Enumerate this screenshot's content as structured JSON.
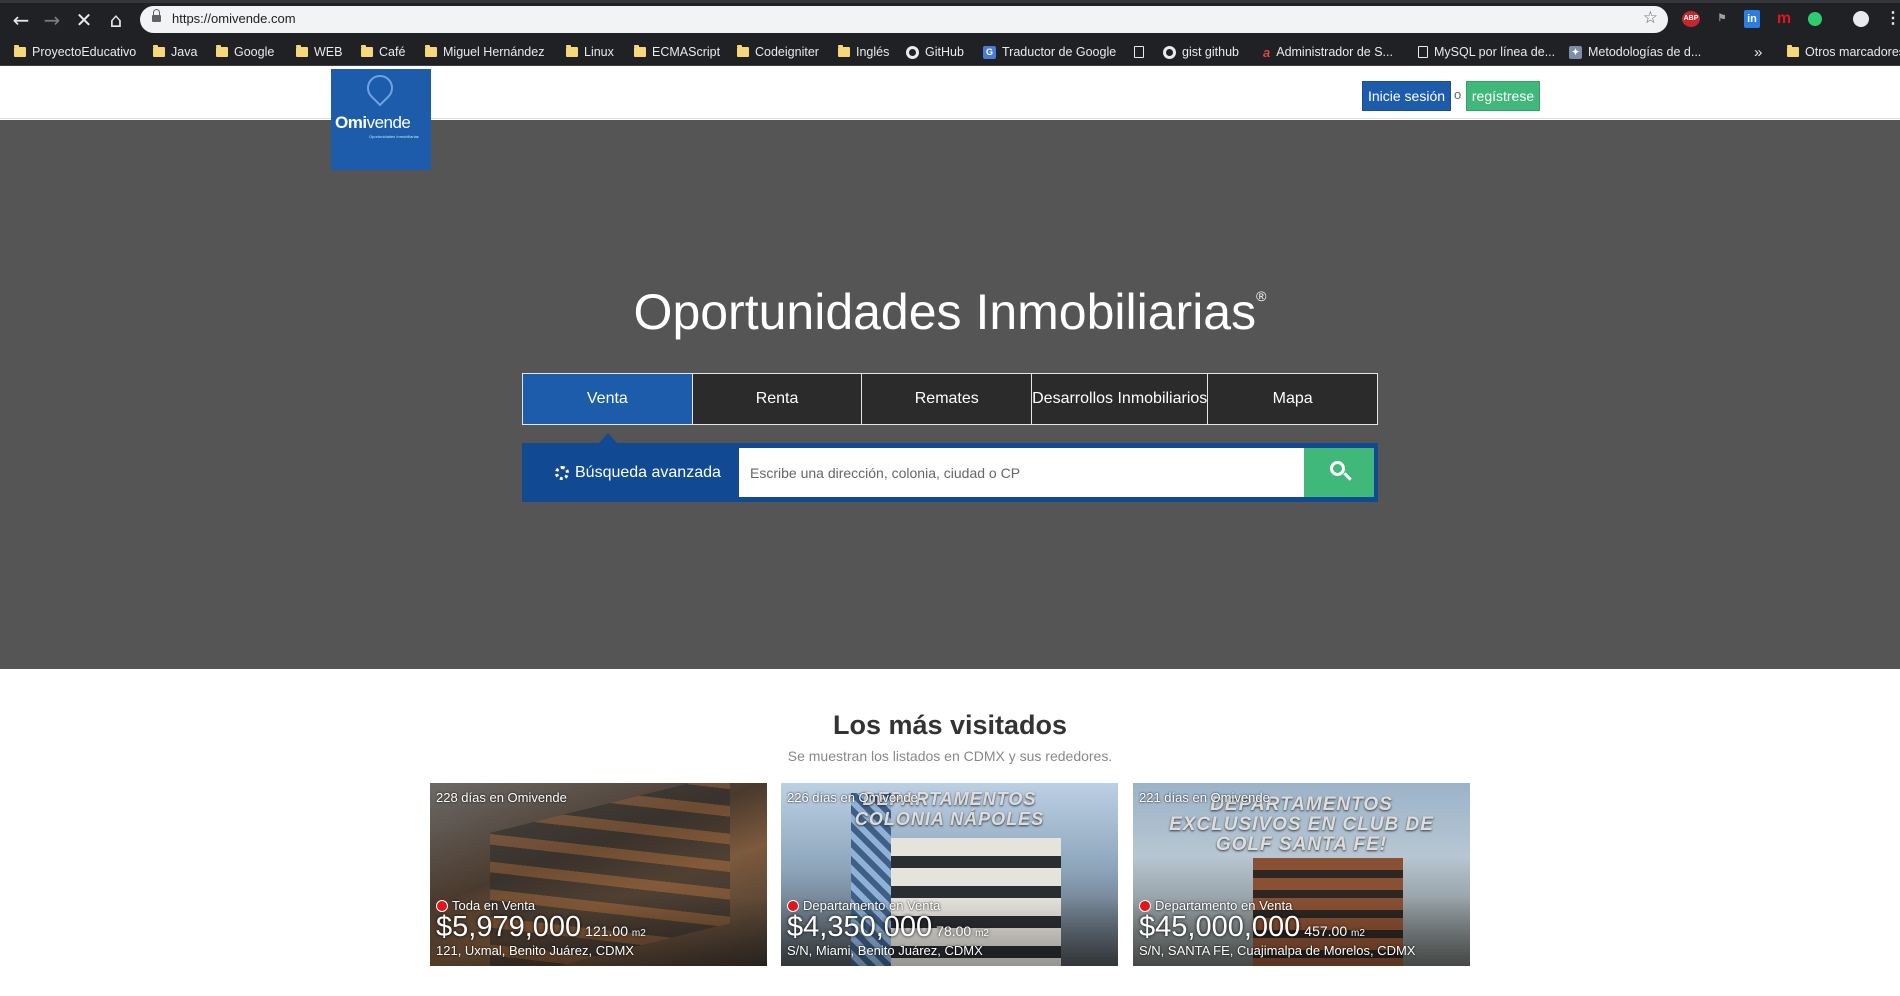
{
  "browser": {
    "url": "https://omivende.com",
    "bookmarks": [
      {
        "label": "ProyectoEducativo",
        "icon": "folder-icon"
      },
      {
        "label": "Java",
        "icon": "folder-icon"
      },
      {
        "label": "Google",
        "icon": "folder-icon"
      },
      {
        "label": "WEB",
        "icon": "folder-icon"
      },
      {
        "label": "Café",
        "icon": "folder-icon"
      },
      {
        "label": "Miguel Hernández",
        "icon": "folder-icon"
      },
      {
        "label": "Linux",
        "icon": "folder-icon"
      },
      {
        "label": "ECMAScript",
        "icon": "folder-icon"
      },
      {
        "label": "Codeigniter",
        "icon": "folder-icon"
      },
      {
        "label": "Inglés",
        "icon": "folder-icon"
      },
      {
        "label": "GitHub",
        "icon": "github-icon"
      },
      {
        "label": "Traductor de Google",
        "icon": "google-translate-icon"
      },
      {
        "label": "",
        "icon": "page-icon"
      },
      {
        "label": "gist github",
        "icon": "github-icon"
      },
      {
        "label": "Administrador de S...",
        "icon": "admin-icon"
      },
      {
        "label": "MySQL por línea de...",
        "icon": "page-icon"
      },
      {
        "label": "Metodologías de d...",
        "icon": "site-icon"
      },
      {
        "label": "Otros marcadores",
        "icon": "folder-icon"
      }
    ],
    "overflow_label": "»",
    "extensions": [
      "ABP",
      "in",
      "m"
    ]
  },
  "header": {
    "logo_text_bold": "Omi",
    "logo_text": "vende",
    "logo_sub": "Oportunidades Inmobiliarias",
    "login_label": "Inicie sesión",
    "or_label": "o",
    "register_label": "regístrese"
  },
  "hero": {
    "title": "Oportunidades Inmobiliarias",
    "title_mark": "®",
    "tabs": [
      "Venta",
      "Renta",
      "Remates",
      "Desarrollos Inmobiliarios",
      "Mapa"
    ],
    "active_tab": "Venta",
    "advanced_search_label": "Búsqueda avanzada",
    "search_placeholder": "Escribe una dirección, colonia, ciudad o CP"
  },
  "most_visited": {
    "title": "Los más visitados",
    "subtitle": "Se muestran los listados en CDMX y sus rededores.",
    "cards": [
      {
        "days": "228 días en Omivende",
        "type": "Toda en Venta",
        "price": "$5,979,000",
        "area": "121.00",
        "unit": "m2",
        "address": "121, Uxmal, Benito Juárez, CDMX",
        "banner": ""
      },
      {
        "days": "226 días en Omivende",
        "type": "Departamento en Venta",
        "price": "$4,350,000",
        "area": "78.00",
        "unit": "m2",
        "address": "S/N, Miami, Benito Juárez, CDMX",
        "banner": "DEPARTAMENTOS COLONIA NÁPOLES"
      },
      {
        "days": "221 días en Omivende",
        "type": "Departamento en Venta",
        "price": "$45,000,000",
        "area": "457.00",
        "unit": "m2",
        "address": "S/N, SANTA FE, Cuajimalpa de Morelos, CDMX",
        "banner": "DEPARTAMENTOS EXCLUSIVOS EN CLUB DE GOLF SANTA FE!"
      }
    ]
  },
  "colors": {
    "brand_blue": "#1d5cab",
    "brand_green": "#3fb87a",
    "hero_bg": "#555555"
  }
}
